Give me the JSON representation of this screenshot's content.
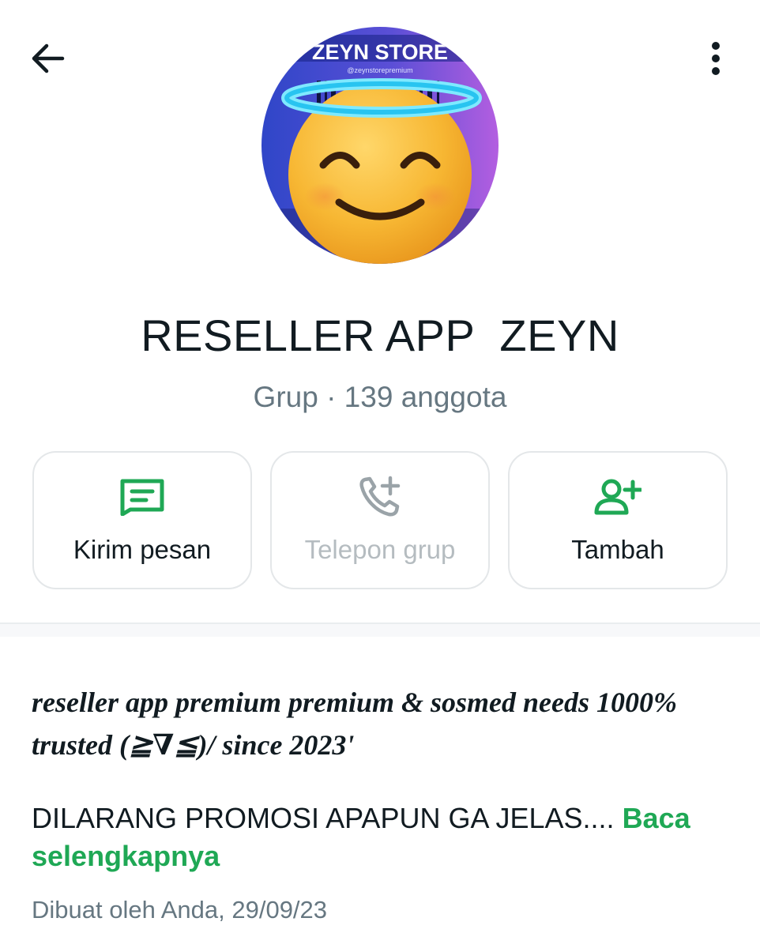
{
  "group": {
    "name": "RESELLER APP  ZEYN",
    "subtitle": "Grup · 139 anggota",
    "avatar_text": "ZEYN STORE",
    "avatar_handle": "@zeynstorepremium"
  },
  "actions": {
    "message_label": "Kirim pesan",
    "call_label": "Telepon grup",
    "add_label": "Tambah"
  },
  "about": {
    "description": "reseller app premium premium & sosmed needs 1000% trusted (≧∇≦)/ since 2023'",
    "rules_text": "DILARANG PROMOSI APAPUN GA JELAS....",
    "read_more": "Baca selengkapnya",
    "created": "Dibuat oleh Anda, 29/09/23"
  },
  "icons": {
    "back": "arrow-left-icon",
    "menu": "more-vertical-icon",
    "message": "message-icon",
    "call": "add-call-icon",
    "add": "add-person-icon"
  },
  "colors": {
    "accent": "#1fa855",
    "text_primary": "#111b21",
    "text_secondary": "#667781",
    "disabled": "#b5bcc0"
  }
}
